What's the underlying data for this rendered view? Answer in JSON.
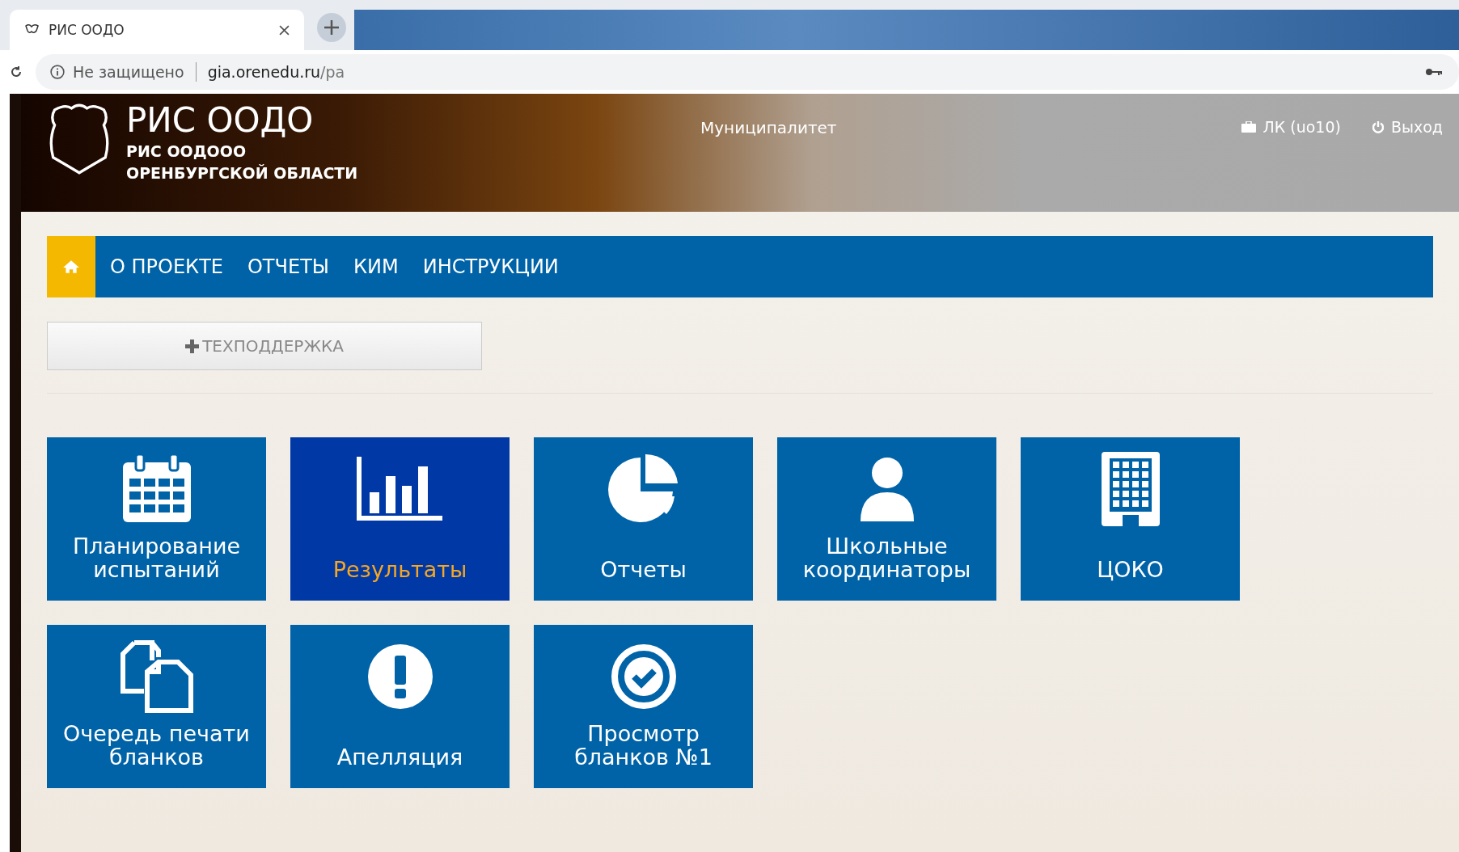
{
  "browser": {
    "tab_title": "РИС ООДО",
    "security": "Не защищено",
    "url_host": "gia.orenedu.ru",
    "url_path": "/pa"
  },
  "header": {
    "title": "РИС ООДО",
    "subtitle": [
      "РИС ООДООО",
      "ОРЕНБУРГСКОЙ ОБЛАСТИ"
    ],
    "role": "Муниципалитет",
    "account": "ЛК (uo10)",
    "logout": "Выход"
  },
  "nav": {
    "items": [
      "О ПРОЕКТЕ",
      "ОТЧЕТЫ",
      "КИМ",
      "ИНСТРУКЦИИ"
    ]
  },
  "support_button": "ТЕХПОДДЕРЖКА",
  "tiles": [
    {
      "label": "Планирование испытаний",
      "kind": "calendar",
      "selected": false
    },
    {
      "label": "Результаты",
      "kind": "bars",
      "selected": true
    },
    {
      "label": "Отчеты",
      "kind": "pie",
      "selected": false
    },
    {
      "label": "Школьные координаторы",
      "kind": "user",
      "selected": false
    },
    {
      "label": "ЦОКО",
      "kind": "building",
      "selected": false
    },
    {
      "label": "Очередь печати бланков",
      "kind": "copy",
      "selected": false
    },
    {
      "label": "Апелляция",
      "kind": "alert",
      "selected": false
    },
    {
      "label": "Просмотр бланков №1",
      "kind": "check",
      "selected": false
    }
  ]
}
